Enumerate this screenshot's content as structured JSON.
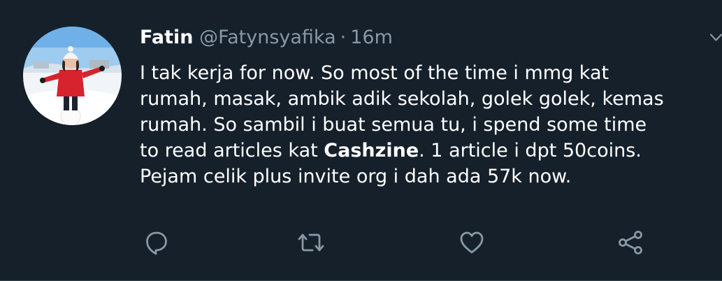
{
  "tweet": {
    "author_name": "Fatin",
    "author_handle": "@Fatynsyafika",
    "separator": "·",
    "time_ago": "16m",
    "body_lines": [
      {
        "before": "I tak kerja for now. So most of the time i mmg kat",
        "bold": "",
        "after": ""
      },
      {
        "before": "rumah, masak, ambik adik sekolah, golek golek, kemas",
        "bold": "",
        "after": ""
      },
      {
        "before": "rumah. So sambil i buat semua tu, i spend some time",
        "bold": "",
        "after": ""
      },
      {
        "before": "to read articles kat ",
        "bold": "Cashzine",
        "after": ". 1 article i dpt 50coins."
      },
      {
        "before": "Pejam celik plus invite org i dah ada 57k now.",
        "bold": "",
        "after": ""
      }
    ]
  },
  "icons": {
    "reply": "reply-icon",
    "retweet": "retweet-icon",
    "like": "like-icon",
    "share": "share-icon",
    "more": "chevron-down-icon"
  },
  "colors": {
    "background": "#15202b",
    "text_primary": "#ffffff",
    "text_secondary": "#8899a6",
    "icon": "#8899a6"
  }
}
